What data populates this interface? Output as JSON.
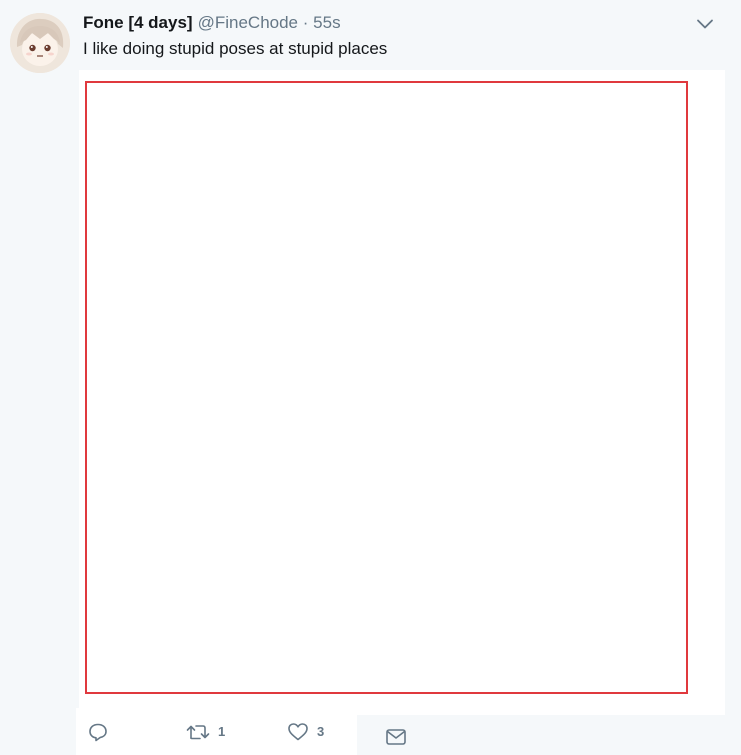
{
  "tweet": {
    "author": {
      "fullname": "Fone [4 days]",
      "username": "@FineChode",
      "avatar_icon": "anime-avatar"
    },
    "separator": "·",
    "timestamp": "55s",
    "text": "I like doing stupid poses at stupid places",
    "actions": {
      "reply": {
        "icon": "reply-icon",
        "count": ""
      },
      "retweet": {
        "icon": "retweet-icon",
        "count": "1"
      },
      "like": {
        "icon": "heart-icon",
        "count": "3"
      },
      "direct_message": {
        "icon": "envelope-icon"
      }
    },
    "colors": {
      "background": "#f5f8fa",
      "text": "#14171a",
      "secondary": "#657786",
      "media_border": "#e0393e"
    }
  }
}
